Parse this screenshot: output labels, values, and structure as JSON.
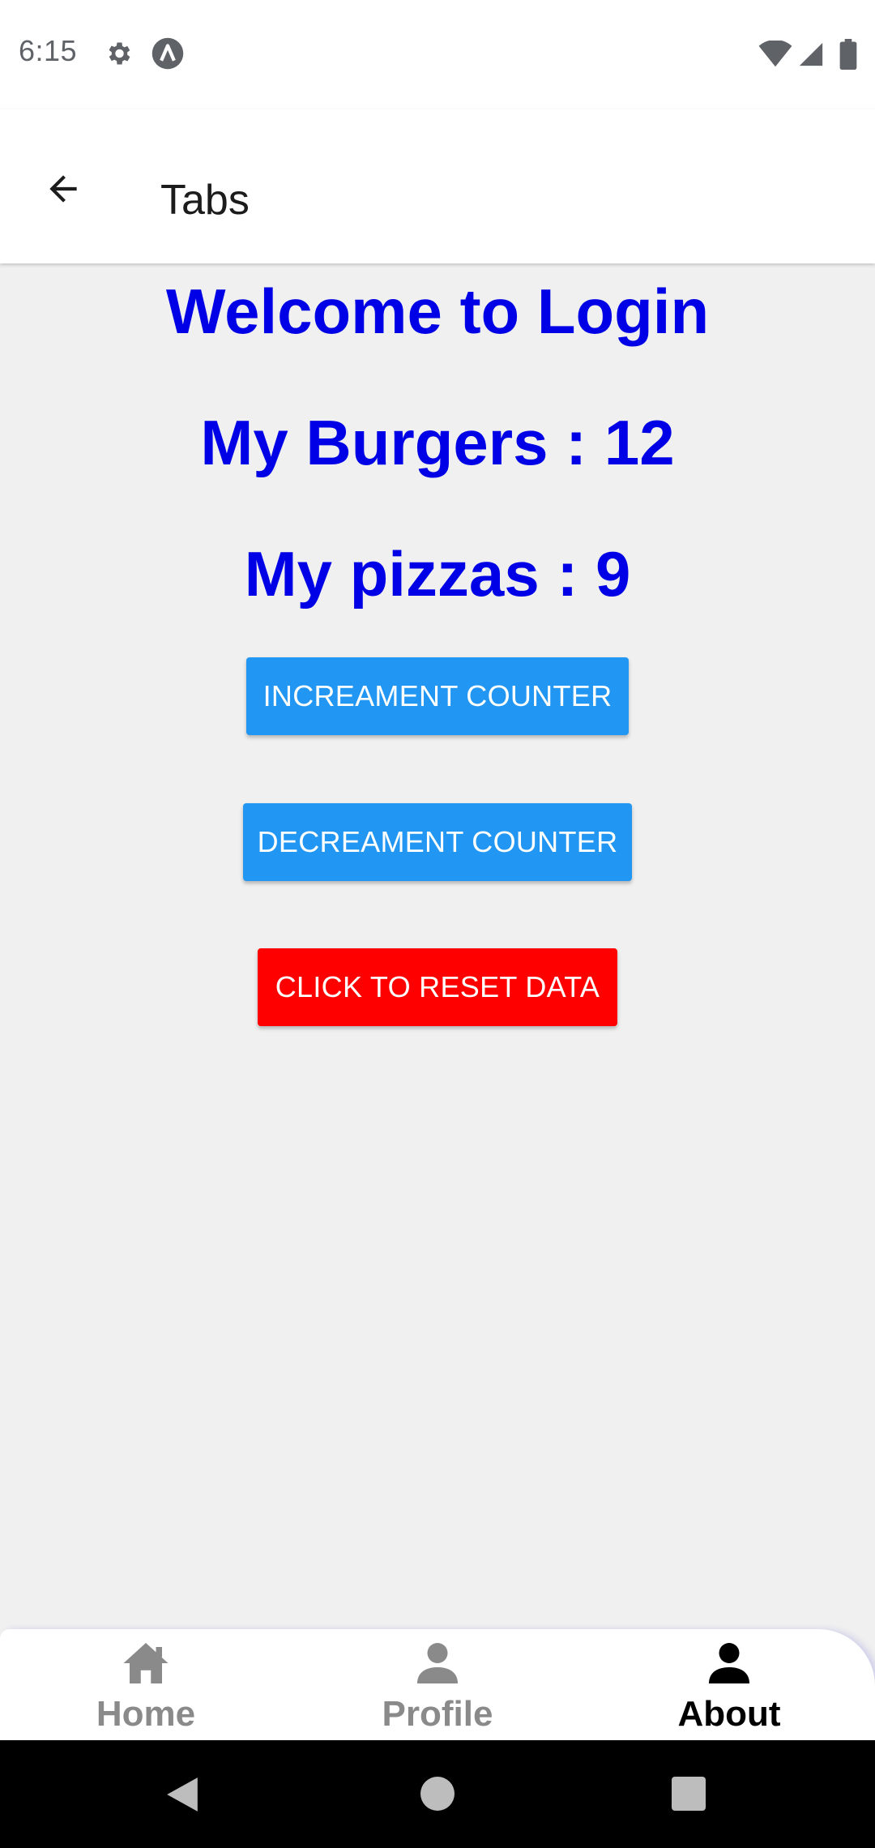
{
  "status_bar": {
    "time": "6:15",
    "icons": [
      "gear-icon",
      "a-icon",
      "wifi-icon",
      "signal-icon",
      "battery-icon"
    ]
  },
  "app_bar": {
    "title": "Tabs",
    "back_icon": "arrow-left-icon"
  },
  "main": {
    "welcome": "Welcome to Login",
    "burgers": "My Burgers : 12",
    "pizzas": "My pizzas : 9",
    "increment_label": "INCREAMENT COUNTER",
    "decrement_label": "DECREAMENT COUNTER",
    "reset_label": "CLICK TO RESET DATA"
  },
  "tabs": [
    {
      "label": "Home",
      "icon": "home-icon",
      "active": false
    },
    {
      "label": "Profile",
      "icon": "person-icon",
      "active": false
    },
    {
      "label": "About",
      "icon": "person-icon",
      "active": true
    }
  ],
  "colors": {
    "heading": "#0000e6",
    "primary_button": "#2196f3",
    "reset_button": "#ff0000",
    "tab_inactive": "#8a8a8a",
    "tab_active": "#000000"
  }
}
